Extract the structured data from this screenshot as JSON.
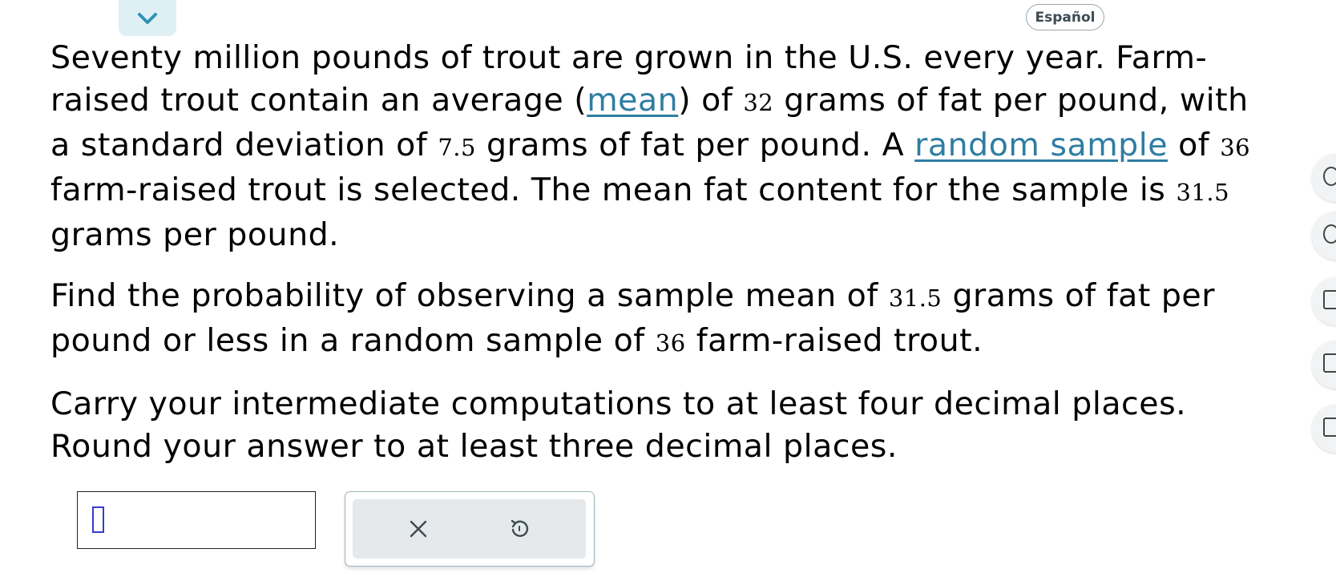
{
  "header": {
    "collapse_icon": "chevron-down-icon",
    "language_button": "Español"
  },
  "problem": {
    "p1": {
      "s1": "Seventy million pounds of trout are grown in the U.S. every year. Farm-raised trout contain an average (",
      "link_mean": "mean",
      "s2": ") of ",
      "mean_value": "32",
      "s3": " grams of fat per pound, with a standard deviation of ",
      "sd_value": "7.5",
      "s4": " grams of fat per pound. A ",
      "link_random_sample": "random sample",
      "s5": " of ",
      "n_value": "36",
      "s6": " farm-raised trout is selected. The mean fat content for the sample is ",
      "sample_mean_value": "31.5",
      "s7": " grams per pound."
    },
    "p2": {
      "s1": "Find the probability of observing a sample mean of ",
      "sample_mean_value": "31.5",
      "s2": " grams of fat per pound or less in a random sample of ",
      "n_value": "36",
      "s3": " farm-raised trout."
    },
    "p3": {
      "line1": "Carry your intermediate computations to at least four decimal places.",
      "line2": "Round your answer to at least three decimal places."
    }
  },
  "answer": {
    "value": ""
  },
  "tools": {
    "clear_icon": "close-icon",
    "undo_icon": "undo-icon"
  },
  "side_toolbar": {
    "icons": [
      "help-icon",
      "chat-icon",
      "calculator-icon",
      "textbook-icon",
      "email-icon"
    ]
  },
  "colors": {
    "link": "#2f7da2",
    "collapse_tab": "#dff0f4",
    "tool_panel_bg": "#e5e9eb",
    "caret": "#3a3ad0"
  }
}
